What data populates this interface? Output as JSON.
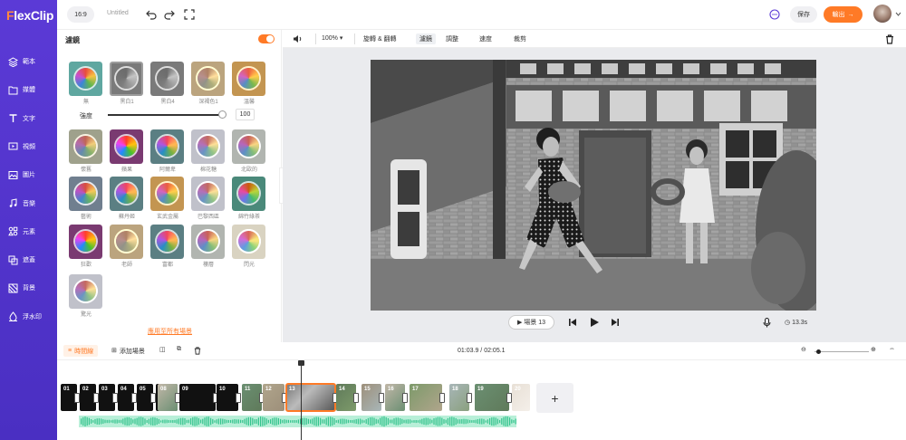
{
  "app": {
    "logo_prefix": "F",
    "logo_rest": "lexClip"
  },
  "sidebar": {
    "items": [
      {
        "label": "範本",
        "icon": "template-icon"
      },
      {
        "label": "媒體",
        "icon": "media-icon"
      },
      {
        "label": "文字",
        "icon": "text-icon"
      },
      {
        "label": "視頻",
        "icon": "video-icon"
      },
      {
        "label": "圖片",
        "icon": "image-icon"
      },
      {
        "label": "音樂",
        "icon": "music-icon"
      },
      {
        "label": "元素",
        "icon": "elements-icon"
      },
      {
        "label": "遮蓋",
        "icon": "overlay-icon"
      },
      {
        "label": "背景",
        "icon": "background-icon"
      },
      {
        "label": "浮水印",
        "icon": "watermark-icon"
      }
    ]
  },
  "topbar": {
    "ratio": "16:9",
    "title": "Untitled",
    "save_label": "保存",
    "export_label": "輸出"
  },
  "filter_panel": {
    "title": "濾鏡",
    "strength_label": "強度",
    "strength_value": "100",
    "strength_fraction": 1.0,
    "apply_all": "應用至所有場景",
    "filters": [
      {
        "label": "無",
        "tone": "normal"
      },
      {
        "label": "黑白1",
        "tone": "bw",
        "selected": true
      },
      {
        "label": "黑白4",
        "tone": "bw"
      },
      {
        "label": "深褐色1",
        "tone": "sepia"
      },
      {
        "label": "溫馨",
        "tone": "warm"
      },
      {
        "label": "懷舊",
        "tone": "vintage"
      },
      {
        "label": "蘋果",
        "tone": "vivid"
      },
      {
        "label": "阿爾卑",
        "tone": "cool"
      },
      {
        "label": "棉花糖",
        "tone": "pastel"
      },
      {
        "label": "北歐的",
        "tone": "faded"
      },
      {
        "label": "藝術",
        "tone": "art"
      },
      {
        "label": "蘇丹姬",
        "tone": "cool"
      },
      {
        "label": "玄武金屬",
        "tone": "warm"
      },
      {
        "label": "巴黎西區",
        "tone": "pastel"
      },
      {
        "label": "綿竹綠茶",
        "tone": "green"
      },
      {
        "label": "狂歡",
        "tone": "vivid"
      },
      {
        "label": "老師",
        "tone": "sepia"
      },
      {
        "label": "富都",
        "tone": "cool"
      },
      {
        "label": "樓層",
        "tone": "faded"
      },
      {
        "label": "閃光",
        "tone": "bright"
      },
      {
        "label": "驚光",
        "tone": "pastel"
      }
    ]
  },
  "edit_tools": {
    "zoom": "100%",
    "items": [
      "旋轉 & 翻轉",
      "濾鏡",
      "調整",
      "速度",
      "裁剪"
    ],
    "active": "濾鏡"
  },
  "player": {
    "scene_label": "場景 13",
    "duration": "13.3s"
  },
  "timeline": {
    "tab_label": "時間線",
    "add_scene_label": "添加場景",
    "timecode": "01:03.9 / 02:05.1",
    "clips": [
      {
        "num": "01",
        "kind": "dark"
      },
      {
        "num": "02",
        "kind": "dark"
      },
      {
        "num": "03",
        "kind": "dark"
      },
      {
        "num": "04",
        "kind": "dark"
      },
      {
        "num": "05",
        "kind": "dark"
      },
      {
        "num": "06",
        "kind": "dark"
      },
      {
        "num": "07",
        "kind": "dark"
      },
      {
        "num": "08",
        "kind": "photo"
      },
      {
        "num": "09",
        "kind": "dark"
      },
      {
        "num": "10",
        "kind": "dark"
      },
      {
        "num": "11",
        "kind": "photo"
      },
      {
        "num": "12",
        "kind": "photo"
      },
      {
        "num": "13",
        "kind": "bw",
        "selected": true
      },
      {
        "num": "14",
        "kind": "photo"
      },
      {
        "num": "15",
        "kind": "photo"
      },
      {
        "num": "16",
        "kind": "photo"
      },
      {
        "num": "17",
        "kind": "photo"
      },
      {
        "num": "18",
        "kind": "photo"
      },
      {
        "num": "19",
        "kind": "photo"
      },
      {
        "num": "20",
        "kind": "faded"
      }
    ],
    "add_label": "+"
  }
}
